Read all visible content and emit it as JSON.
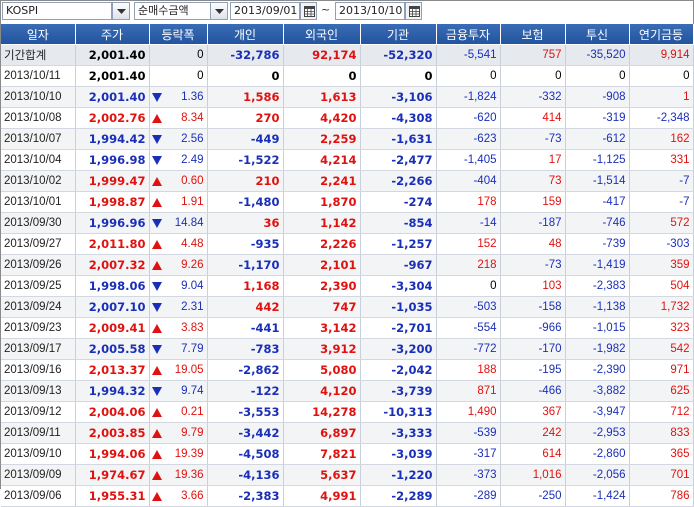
{
  "toolbar": {
    "market_select": "KOSPI",
    "type_select": "순매수금액",
    "date_from": "2013/09/01",
    "date_separator": "~",
    "date_to": "2013/10/10"
  },
  "colors": {
    "up": "#e0120f",
    "down": "#1a2fb8",
    "header": "#2d60aa"
  },
  "columns": [
    "일자",
    "주가",
    "등락폭",
    "개인",
    "외국인",
    "기관",
    "금융투자",
    "보험",
    "투신",
    "연기금등"
  ],
  "rows": [
    {
      "date": "기간합계",
      "price": "2,001.40",
      "dir": "",
      "change": "0",
      "individual": "-32,786",
      "foreign": "92,174",
      "institution": "-52,320",
      "fin_invest": "-5,541",
      "insurance": "757",
      "trust": "-35,520",
      "pension": "9,914"
    },
    {
      "date": "2013/10/11",
      "price": "2,001.40",
      "dir": "",
      "change": "0",
      "individual": "0",
      "foreign": "0",
      "institution": "0",
      "fin_invest": "0",
      "insurance": "0",
      "trust": "0",
      "pension": "0"
    },
    {
      "date": "2013/10/10",
      "price": "2,001.40",
      "dir": "down",
      "change": "1.36",
      "individual": "1,586",
      "foreign": "1,613",
      "institution": "-3,106",
      "fin_invest": "-1,824",
      "insurance": "-332",
      "trust": "-908",
      "pension": "1"
    },
    {
      "date": "2013/10/08",
      "price": "2,002.76",
      "dir": "up",
      "change": "8.34",
      "individual": "270",
      "foreign": "4,420",
      "institution": "-4,308",
      "fin_invest": "-620",
      "insurance": "414",
      "trust": "-319",
      "pension": "-2,348"
    },
    {
      "date": "2013/10/07",
      "price": "1,994.42",
      "dir": "down",
      "change": "2.56",
      "individual": "-449",
      "foreign": "2,259",
      "institution": "-1,631",
      "fin_invest": "-623",
      "insurance": "-73",
      "trust": "-612",
      "pension": "162"
    },
    {
      "date": "2013/10/04",
      "price": "1,996.98",
      "dir": "down",
      "change": "2.49",
      "individual": "-1,522",
      "foreign": "4,214",
      "institution": "-2,477",
      "fin_invest": "-1,405",
      "insurance": "17",
      "trust": "-1,125",
      "pension": "331"
    },
    {
      "date": "2013/10/02",
      "price": "1,999.47",
      "dir": "up",
      "change": "0.60",
      "individual": "210",
      "foreign": "2,241",
      "institution": "-2,266",
      "fin_invest": "-404",
      "insurance": "73",
      "trust": "-1,514",
      "pension": "-7"
    },
    {
      "date": "2013/10/01",
      "price": "1,998.87",
      "dir": "up",
      "change": "1.91",
      "individual": "-1,480",
      "foreign": "1,870",
      "institution": "-274",
      "fin_invest": "178",
      "insurance": "159",
      "trust": "-417",
      "pension": "-7"
    },
    {
      "date": "2013/09/30",
      "price": "1,996.96",
      "dir": "down",
      "change": "14.84",
      "individual": "36",
      "foreign": "1,142",
      "institution": "-854",
      "fin_invest": "-14",
      "insurance": "-187",
      "trust": "-746",
      "pension": "572"
    },
    {
      "date": "2013/09/27",
      "price": "2,011.80",
      "dir": "up",
      "change": "4.48",
      "individual": "-935",
      "foreign": "2,226",
      "institution": "-1,257",
      "fin_invest": "152",
      "insurance": "48",
      "trust": "-739",
      "pension": "-303"
    },
    {
      "date": "2013/09/26",
      "price": "2,007.32",
      "dir": "up",
      "change": "9.26",
      "individual": "-1,170",
      "foreign": "2,101",
      "institution": "-967",
      "fin_invest": "218",
      "insurance": "-73",
      "trust": "-1,419",
      "pension": "359"
    },
    {
      "date": "2013/09/25",
      "price": "1,998.06",
      "dir": "down",
      "change": "9.04",
      "individual": "1,168",
      "foreign": "2,390",
      "institution": "-3,304",
      "fin_invest": "0",
      "insurance": "103",
      "trust": "-2,383",
      "pension": "504"
    },
    {
      "date": "2013/09/24",
      "price": "2,007.10",
      "dir": "down",
      "change": "2.31",
      "individual": "442",
      "foreign": "747",
      "institution": "-1,035",
      "fin_invest": "-503",
      "insurance": "-158",
      "trust": "-1,138",
      "pension": "1,732"
    },
    {
      "date": "2013/09/23",
      "price": "2,009.41",
      "dir": "up",
      "change": "3.83",
      "individual": "-441",
      "foreign": "3,142",
      "institution": "-2,701",
      "fin_invest": "-554",
      "insurance": "-966",
      "trust": "-1,015",
      "pension": "323"
    },
    {
      "date": "2013/09/17",
      "price": "2,005.58",
      "dir": "down",
      "change": "7.79",
      "individual": "-783",
      "foreign": "3,912",
      "institution": "-3,200",
      "fin_invest": "-772",
      "insurance": "-170",
      "trust": "-1,982",
      "pension": "542"
    },
    {
      "date": "2013/09/16",
      "price": "2,013.37",
      "dir": "up",
      "change": "19.05",
      "individual": "-2,862",
      "foreign": "5,080",
      "institution": "-2,042",
      "fin_invest": "188",
      "insurance": "-195",
      "trust": "-2,390",
      "pension": "971"
    },
    {
      "date": "2013/09/13",
      "price": "1,994.32",
      "dir": "down",
      "change": "9.74",
      "individual": "-122",
      "foreign": "4,120",
      "institution": "-3,739",
      "fin_invest": "871",
      "insurance": "-466",
      "trust": "-3,882",
      "pension": "625"
    },
    {
      "date": "2013/09/12",
      "price": "2,004.06",
      "dir": "up",
      "change": "0.21",
      "individual": "-3,553",
      "foreign": "14,278",
      "institution": "-10,313",
      "fin_invest": "1,490",
      "insurance": "367",
      "trust": "-3,947",
      "pension": "712"
    },
    {
      "date": "2013/09/11",
      "price": "2,003.85",
      "dir": "up",
      "change": "9.79",
      "individual": "-3,442",
      "foreign": "6,897",
      "institution": "-3,333",
      "fin_invest": "-539",
      "insurance": "242",
      "trust": "-2,953",
      "pension": "833"
    },
    {
      "date": "2013/09/10",
      "price": "1,994.06",
      "dir": "up",
      "change": "19.39",
      "individual": "-4,508",
      "foreign": "7,821",
      "institution": "-3,039",
      "fin_invest": "-317",
      "insurance": "614",
      "trust": "-2,860",
      "pension": "365"
    },
    {
      "date": "2013/09/09",
      "price": "1,974.67",
      "dir": "up",
      "change": "19.36",
      "individual": "-4,136",
      "foreign": "5,637",
      "institution": "-1,220",
      "fin_invest": "-373",
      "insurance": "1,016",
      "trust": "-2,056",
      "pension": "701"
    },
    {
      "date": "2013/09/06",
      "price": "1,955.31",
      "dir": "up",
      "change": "3.66",
      "individual": "-2,383",
      "foreign": "4,991",
      "institution": "-2,289",
      "fin_invest": "-289",
      "insurance": "-250",
      "trust": "-1,424",
      "pension": "786"
    }
  ]
}
